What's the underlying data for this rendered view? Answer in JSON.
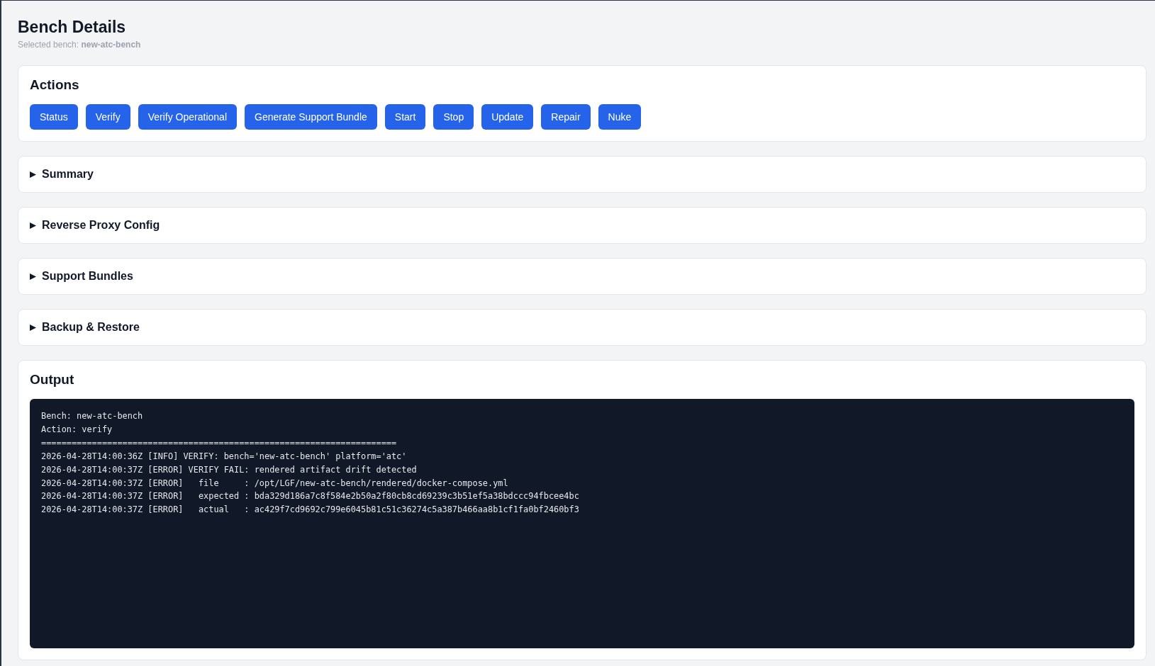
{
  "header": {
    "title": "Bench Details",
    "subtitle": "Selected bench: **new-atc-bench**"
  },
  "actions": {
    "title": "Actions",
    "buttons": [
      "Status",
      "Verify",
      "Verify Operational",
      "Generate Support Bundle",
      "Start",
      "Stop",
      "Update",
      "Repair",
      "Nuke"
    ]
  },
  "sections": [
    {
      "label": "Summary",
      "expanded": false
    },
    {
      "label": "Reverse Proxy Config",
      "expanded": false
    },
    {
      "label": "Support Bundles",
      "expanded": false
    },
    {
      "label": "Backup & Restore",
      "expanded": false
    }
  ],
  "output": {
    "title": "Output",
    "lines": [
      "Bench: new-atc-bench",
      "Action: verify",
      "======================================================================",
      "2026-04-28T14:00:36Z [INFO] VERIFY: bench='new-atc-bench' platform='atc'",
      "2026-04-28T14:00:37Z [ERROR] VERIFY FAIL: rendered artifact drift detected",
      "2026-04-28T14:00:37Z [ERROR]   file     : /opt/LGF/new-atc-bench/rendered/docker-compose.yml",
      "2026-04-28T14:00:37Z [ERROR]   expected : bda329d186a7c8f584e2b50a2f80cb8cd69239c3b51ef5a38bdccc94fbcee4bc",
      "2026-04-28T14:00:37Z [ERROR]   actual   : ac429f7cd9692c799e6045b81c51c36274c5a387b466aa8b1cf1fa0bf2460bf3"
    ]
  }
}
